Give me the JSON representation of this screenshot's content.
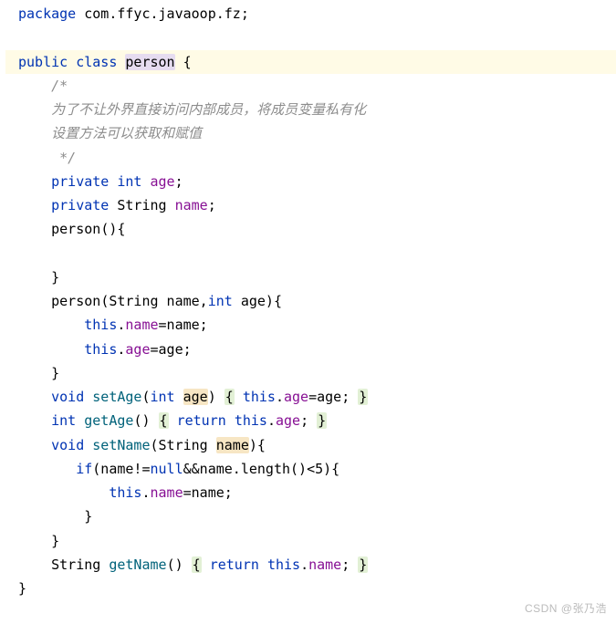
{
  "code": {
    "l1_pkg": "package",
    "l1_path": "com.ffyc.javaoop.fz;",
    "l3_pub": "public",
    "l3_cls": "class",
    "l3_name": "person",
    "l3_brace": " {",
    "l4": "    /*",
    "l5": "    为了不让外界直接访问内部成员，将成员变量私有化",
    "l6": "    设置方法可以获取和赋值",
    "l7": "     */",
    "l8_priv": "private",
    "l8_int": "int",
    "l8_age": "age",
    "l9_priv": "private",
    "l9_str": "String",
    "l9_name": "name",
    "l10_ctor": "person",
    "l12_close": "    }",
    "l13_ctor": "person",
    "l13_sig1": "(String name,",
    "l13_int": "int",
    "l13_sig2": " age){",
    "l14_this": "this",
    "l14_field": "name",
    "l14_rest": "=name;",
    "l15_this": "this",
    "l15_field": "age",
    "l15_rest": "=age;",
    "l16_close": "    }",
    "l17_void": "void",
    "l17_m": "setAge",
    "l17_int": "int",
    "l17_param": "age",
    "l17_ob": "{",
    "l17_this": "this",
    "l17_field": "age",
    "l17_rest": "=age;",
    "l17_cb": "}",
    "l18_int": "int",
    "l18_m": "getAge",
    "l18_ob": "{",
    "l18_ret": "return",
    "l18_this": "this",
    "l18_field": "age",
    "l18_cb": "}",
    "l19_void": "void",
    "l19_m": "setName",
    "l19_sig1": "(String ",
    "l19_param": "name",
    "l19_sig2": "){",
    "l20_if": "if",
    "l20_cond": "(name!=",
    "l20_null": "null",
    "l20_cond2": "&&name.length()<",
    "l20_num": "5",
    "l20_cond3": "){",
    "l21_this": "this",
    "l21_field": "name",
    "l21_rest": "=name;",
    "l22_close": "        }",
    "l23_close": "    }",
    "l24_str": "String",
    "l24_m": "getName",
    "l24_ob": "{",
    "l24_ret": "return",
    "l24_this": "this",
    "l24_field": "name",
    "l24_cb": "}",
    "l25_close": "}"
  },
  "watermark": "CSDN @张乃浩"
}
